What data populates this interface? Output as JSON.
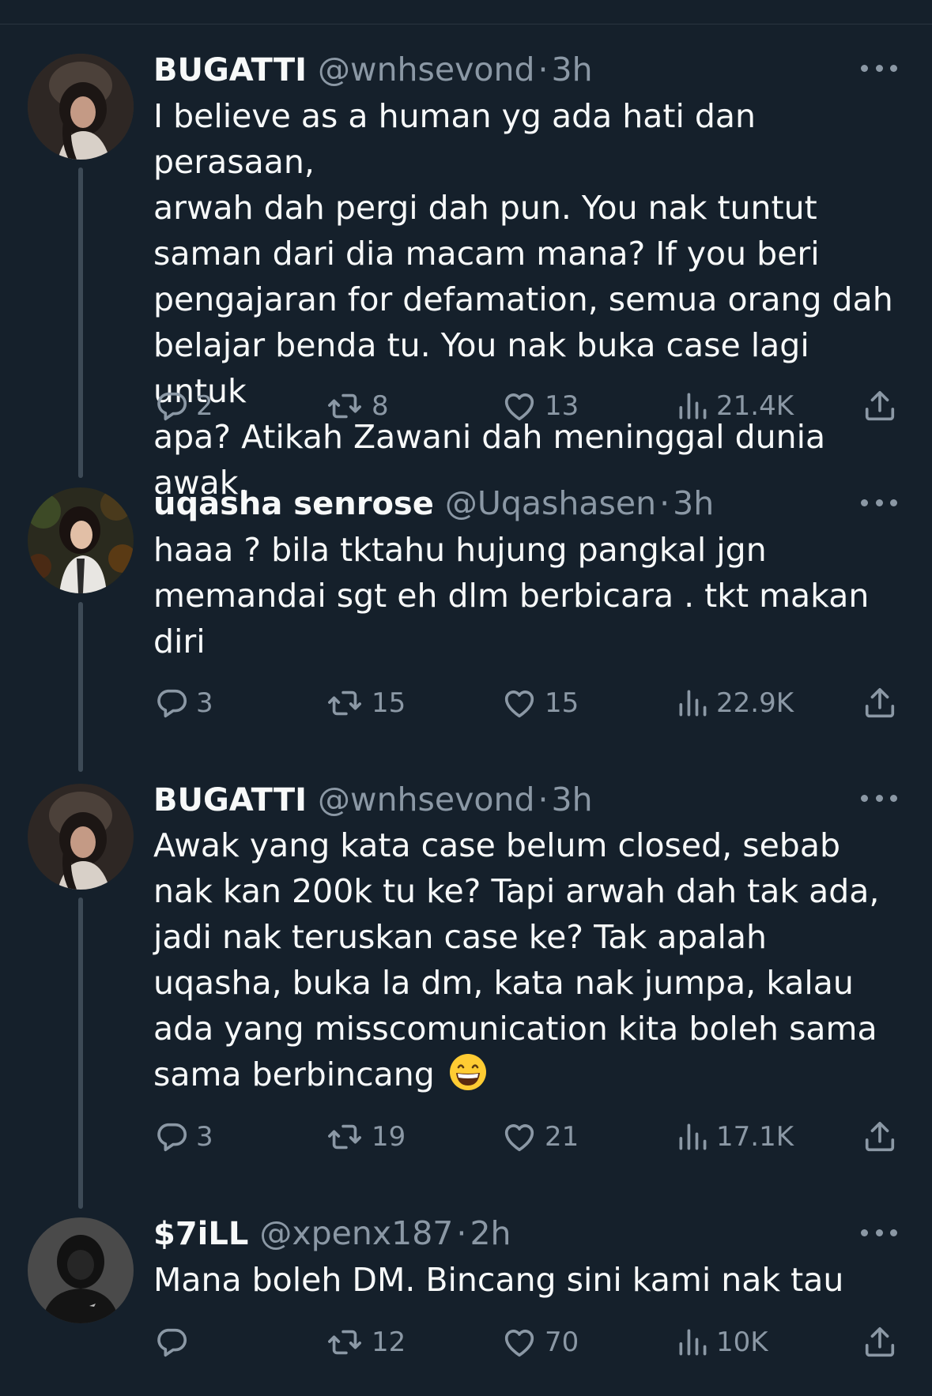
{
  "colors": {
    "background": "#15202b",
    "text": "#f7f9f9",
    "secondary": "#8b98a5",
    "thread_line": "#3d4a56"
  },
  "tweets": [
    {
      "display_name": "BUGATTI",
      "handle": "@wnhsevond",
      "separator": "·",
      "time": "3h",
      "text": "I believe as a human yg ada hati dan perasaan,\narwah dah pergi dah pun. You nak tuntut\nsaman dari dia macam mana? If you beri\npengajaran for defamation, semua orang dah\nbelajar benda tu. You nak buka case lagi untuk\napa? Atikah Zawani dah meninggal dunia awak.",
      "emoji": "",
      "replies": "2",
      "retweets": "8",
      "likes": "13",
      "views": "21.4K"
    },
    {
      "display_name": "uqasha senrose",
      "handle": "@Uqashasen",
      "separator": "·",
      "time": "3h",
      "text": "haaa ? bila tktahu hujung pangkal jgn\nmemandai sgt eh dlm berbicara . tkt makan\ndiri",
      "emoji": "",
      "replies": "3",
      "retweets": "15",
      "likes": "15",
      "views": "22.9K"
    },
    {
      "display_name": "BUGATTI",
      "handle": "@wnhsevond",
      "separator": "·",
      "time": "3h",
      "text": "Awak yang kata case belum closed, sebab\nnak kan 200k tu ke? Tapi arwah dah tak ada,\njadi nak teruskan case ke? Tak apalah\nuqasha, buka la dm, kata nak jumpa, kalau\nada yang misscomunication kita boleh sama\nsama berbincang ",
      "emoji": "grinning-face-emoji",
      "replies": "3",
      "retweets": "19",
      "likes": "21",
      "views": "17.1K"
    },
    {
      "display_name": "$7iLL",
      "handle": "@xpenx187",
      "separator": "·",
      "time": "2h",
      "text": "Mana boleh DM. Bincang sini kami nak tau",
      "emoji": "",
      "replies": "",
      "retweets": "12",
      "likes": "70",
      "views": "10K"
    }
  ],
  "icons": {
    "reply": "reply-icon",
    "retweet": "retweet-icon",
    "like": "heart-icon",
    "views": "views-icon",
    "share": "share-icon",
    "more": "more-icon"
  }
}
